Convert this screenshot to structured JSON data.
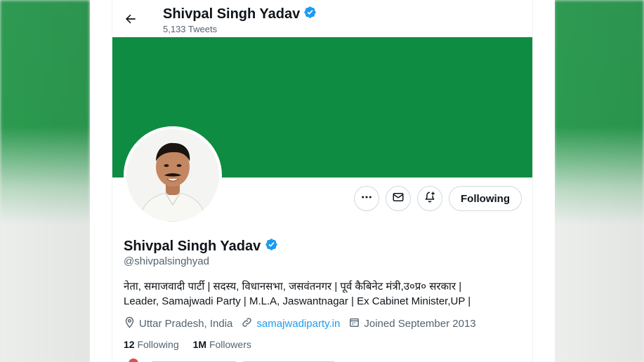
{
  "header": {
    "name": "Shivpal Singh Yadav",
    "tweet_count": "5,133 Tweets"
  },
  "colors": {
    "banner": "#0e8c42",
    "verified": "#1d9bf0",
    "link": "#1d9bf0"
  },
  "actions": {
    "more_icon": "more-icon",
    "message_icon": "mail-icon",
    "notify_icon": "bell-plus-icon",
    "follow_label": "Following"
  },
  "profile": {
    "name": "Shivpal Singh Yadav",
    "handle": "@shivpalsinghyad",
    "bio_line1": "नेता, समाजवादी पार्टी | सदस्य, विधानसभा, जसवंतनगर | पूर्व कैबिनेट मंत्री,उ०प्र० सरकार |",
    "bio_line2": "Leader, Samajwadi Party | M.L.A, Jaswantnagar | Ex Cabinet Minister,UP |",
    "location": "Uttar Pradesh, India",
    "website": "samajwadiparty.in",
    "joined": "Joined September 2013",
    "following_count": "12",
    "following_label": "Following",
    "followers_count": "1M",
    "followers_label": "Followers"
  }
}
